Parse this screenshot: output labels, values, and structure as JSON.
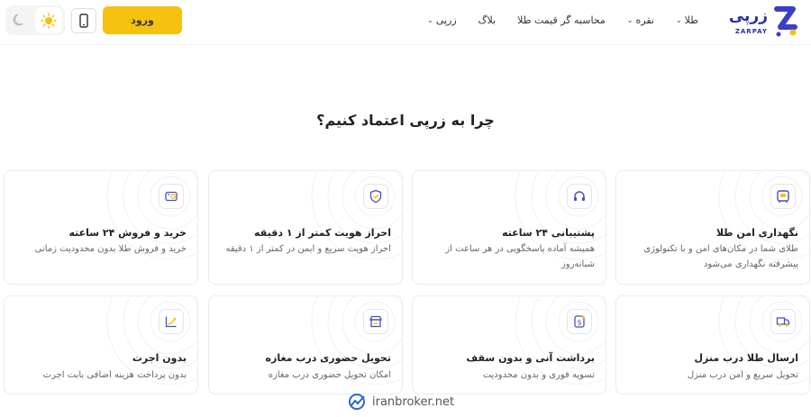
{
  "header": {
    "logo_text": "زرپی",
    "logo_sub": "ZARPAY",
    "nav": [
      {
        "label": "طلا",
        "has_menu": true
      },
      {
        "label": "نقره",
        "has_menu": true
      },
      {
        "label": "محاسبه گر قیمت طلا",
        "has_menu": false
      },
      {
        "label": "بلاگ",
        "has_menu": false
      },
      {
        "label": "زرپی",
        "has_menu": true
      }
    ],
    "login_label": "ورود"
  },
  "section_title": "چرا به زرپی اعتماد کنیم؟",
  "cards": [
    {
      "title": "نگهداری امن طلا",
      "desc": "طلای شما در مکان‌های امن و با تکنولوژی پیشرفته نگهداری می‌شود",
      "icon": "safe-icon"
    },
    {
      "title": "پشتیبانی ۲۴ ساعته",
      "desc": "همیشه آماده پاسخگویی در هر ساعت از شبانه‌روز",
      "icon": "headset-icon"
    },
    {
      "title": "احراز هویت کمتر از ۱ دقیقه",
      "desc": "احراز هویت سریع و ایمن در کمتر از ۱ دقیقه",
      "icon": "shield-check-icon"
    },
    {
      "title": "خرید و فروش ۲۴ ساعته",
      "desc": "خرید و فروش طلا بدون محدودیت زمانی",
      "icon": "coin-swap-icon"
    },
    {
      "title": "ارسال طلا درب منزل",
      "desc": "تحویل سریع و امن درب منزل",
      "icon": "delivery-truck-icon"
    },
    {
      "title": "برداشت آنی و بدون سقف",
      "desc": "تسویه فوری و بدون محدودیت",
      "icon": "instant-withdraw-icon"
    },
    {
      "title": "تحویل حضوری درب مغازه",
      "desc": "امکان تحویل حضوری درب مغازه",
      "icon": "store-icon"
    },
    {
      "title": "بدون اجرت",
      "desc": "بدون پرداخت هزینه اضافی بابت اجرت",
      "icon": "growth-chart-icon"
    }
  ],
  "watermark": "iranbroker.net",
  "colors": {
    "accent": "#f6c10f",
    "brand": "#2b2f9e",
    "icon": "#4b4fb8"
  }
}
